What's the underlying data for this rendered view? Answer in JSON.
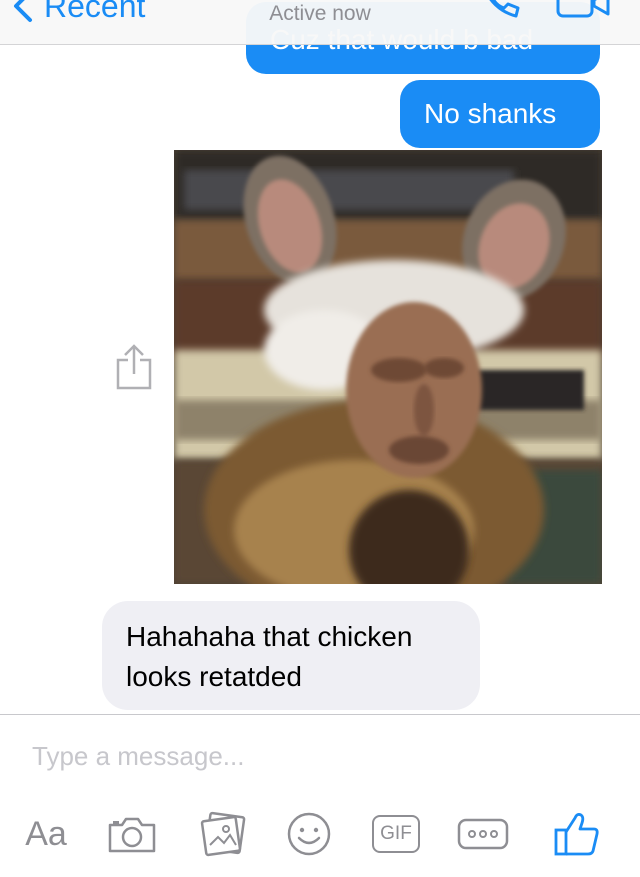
{
  "header": {
    "back_label": "Recent",
    "status": "Active now"
  },
  "messages": {
    "partial_out": "Cuz that would b bad",
    "out_1": "No shanks",
    "in_1_line1": "Hahahaha that chicken",
    "in_1_line2": "looks retatded"
  },
  "composer": {
    "placeholder": "Type a message...",
    "aa_label": "Aa",
    "gif_label": "GIF"
  },
  "colors": {
    "accent": "#1a8cf5",
    "incoming_bubble": "#efeff4",
    "icon_gray": "#8e8e93"
  }
}
